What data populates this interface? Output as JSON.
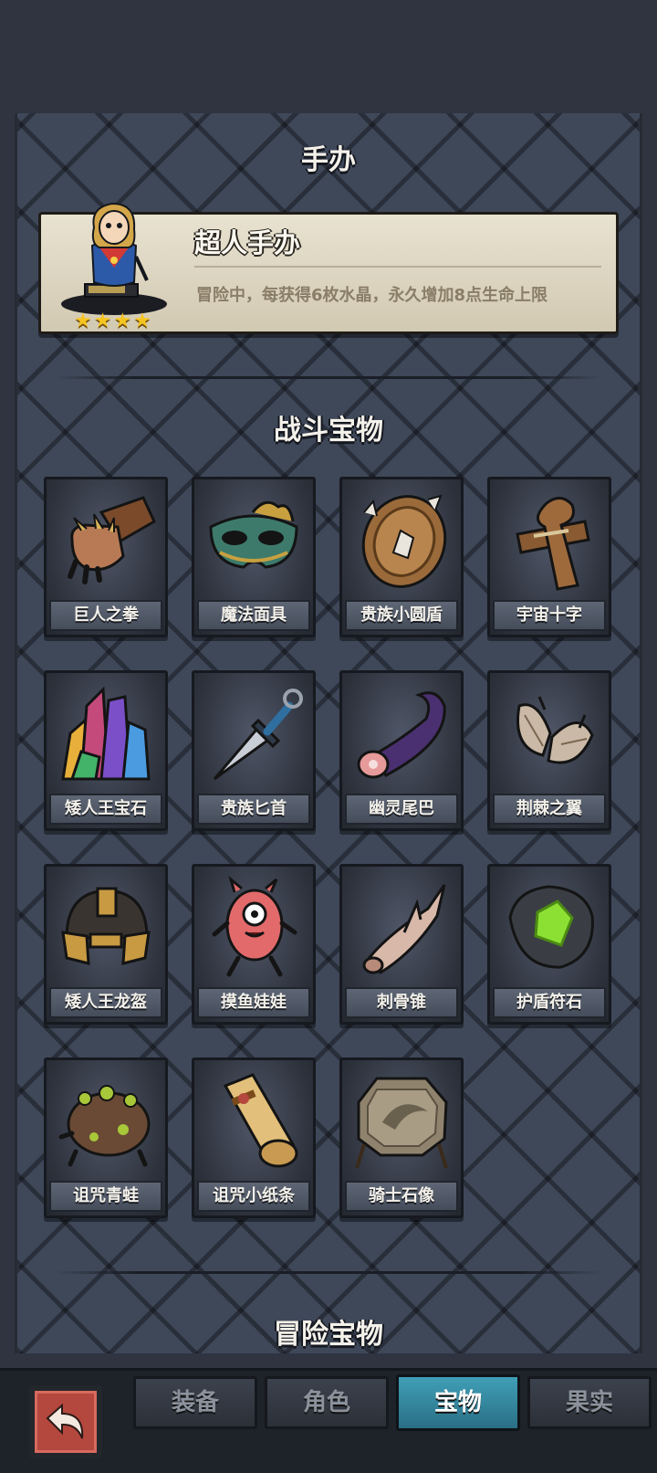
{
  "figure_section": {
    "title": "手办",
    "card": {
      "name": "超人手办",
      "description": "冒险中，每获得6枚水晶，永久增加8点生命上限",
      "stars": "★★★★"
    }
  },
  "battle_treasures": {
    "title": "战斗宝物",
    "items": [
      {
        "label": "巨人之拳",
        "icon": "giant-fist-icon"
      },
      {
        "label": "魔法面具",
        "icon": "magic-mask-icon"
      },
      {
        "label": "贵族小圆盾",
        "icon": "round-shield-icon"
      },
      {
        "label": "宇宙十字",
        "icon": "cosmic-cross-icon"
      },
      {
        "label": "矮人王宝石",
        "icon": "gem-cluster-icon"
      },
      {
        "label": "贵族匕首",
        "icon": "dagger-icon"
      },
      {
        "label": "幽灵尾巴",
        "icon": "ghost-tail-icon"
      },
      {
        "label": "荆棘之翼",
        "icon": "thorn-wings-icon"
      },
      {
        "label": "矮人王龙盔",
        "icon": "dwarf-helmet-icon"
      },
      {
        "label": "摸鱼娃娃",
        "icon": "slacker-doll-icon"
      },
      {
        "label": "刺骨锥",
        "icon": "bone-spike-icon"
      },
      {
        "label": "护盾符石",
        "icon": "shield-rune-stone-icon"
      },
      {
        "label": "诅咒青蛙",
        "icon": "cursed-frog-icon"
      },
      {
        "label": "诅咒小纸条",
        "icon": "cursed-scroll-icon"
      },
      {
        "label": "骑士石像",
        "icon": "knight-statue-icon"
      }
    ]
  },
  "adventure_treasures": {
    "title": "冒险宝物"
  },
  "bottom_nav": {
    "back_icon": "back-arrow-icon",
    "tabs": [
      {
        "label": "装备"
      },
      {
        "label": "角色"
      },
      {
        "label": "宝物",
        "active": true
      },
      {
        "label": "果实"
      }
    ]
  },
  "colors": {
    "star": "#f6c420",
    "active_tab": "#3f9fb6",
    "back_button": "#b4473e",
    "rune_glow": "#8ce033"
  }
}
